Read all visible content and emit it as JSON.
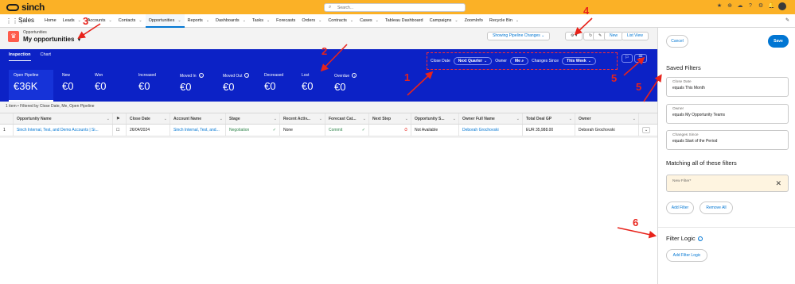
{
  "brand": {
    "name": "sinch"
  },
  "search": {
    "placeholder": "Search..."
  },
  "app": {
    "name": "Sales"
  },
  "nav": [
    {
      "label": "Home",
      "chev": false
    },
    {
      "label": "Leads",
      "chev": true
    },
    {
      "label": "Accounts",
      "chev": true
    },
    {
      "label": "Contacts",
      "chev": true
    },
    {
      "label": "Opportunities",
      "chev": true,
      "active": true
    },
    {
      "label": "Reports",
      "chev": true
    },
    {
      "label": "Dashboards",
      "chev": true
    },
    {
      "label": "Tasks",
      "chev": true
    },
    {
      "label": "Forecasts",
      "chev": false
    },
    {
      "label": "Orders",
      "chev": true
    },
    {
      "label": "Contracts",
      "chev": true
    },
    {
      "label": "Cases",
      "chev": true
    },
    {
      "label": "Tableau Dashboard",
      "chev": false
    },
    {
      "label": "Campaigns",
      "chev": true
    },
    {
      "label": "ZoomInfo",
      "chev": false
    },
    {
      "label": "Recycle Bin",
      "chev": true
    }
  ],
  "header": {
    "object_label": "Opportunities",
    "list_name": "My opportunities",
    "pipeline_btn": "Showing Pipeline Changes",
    "new_btn": "New",
    "listview_btn": "List View"
  },
  "tabs": [
    "Inspection",
    "Chart"
  ],
  "filters": {
    "close_date_label": "Close Date",
    "close_date_value": "Next Quarter",
    "owner_label": "Owner",
    "owner_value": "Me",
    "changes_label": "Changes Since",
    "changes_value": "This Week"
  },
  "metrics": [
    {
      "label": "Open Pipeline",
      "value": "€36K"
    },
    {
      "label": "New",
      "value": "€0"
    },
    {
      "label": "Won",
      "value": "€0"
    },
    {
      "label": "Increased",
      "value": "€0"
    },
    {
      "label": "Moved In",
      "value": "€0"
    },
    {
      "label": "Moved Out",
      "value": "€0"
    },
    {
      "label": "Decreased",
      "value": "€0"
    },
    {
      "label": "Lost",
      "value": "€0"
    },
    {
      "label": "Overdue",
      "value": "€0"
    }
  ],
  "status": "1 item • Filtered by Close Date, Me, Open Pipeline",
  "table": {
    "columns": [
      "Opportunity Name",
      "Close Date",
      "Account Name",
      "Stage",
      "Recent Activ...",
      "Forecast Cat...",
      "Next Step",
      "Opportunity S...",
      "Owner Full Name",
      "Total Deal GP",
      "Owner"
    ],
    "row": {
      "num": "1",
      "name": "Sinch Internal, Test, and Demo Accounts | Si...",
      "close_date": "26/04/2024",
      "account": "Sinch Internal, Test, and...",
      "stage": "Negotiation",
      "recent": "None",
      "forecast": "Commit",
      "next_step": "",
      "opp_status": "Not Available",
      "owner_full": "Deborah Grochovski",
      "gp": "EUR 35,988.00",
      "owner": "Deborah Grochovski"
    }
  },
  "panel": {
    "cancel": "Cancel",
    "save": "Save",
    "saved_title": "Saved Filters",
    "saved": [
      {
        "name": "Close Date",
        "value": "equals  This Month"
      },
      {
        "name": "Owner",
        "value": "equals  My Opportunity Teams"
      },
      {
        "name": "Changes Since",
        "value": "equals  Start of the Period"
      }
    ],
    "matching_title": "Matching all of these filters",
    "new_filter": "New Filter*",
    "add_filter": "Add Filter",
    "remove_all": "Remove All",
    "logic_title": "Filter Logic",
    "add_logic": "Add Filter Logic"
  },
  "annotations": [
    "1",
    "2",
    "3",
    "4",
    "5",
    "5",
    "6"
  ],
  "colors": {
    "topbar": "#fbb126",
    "banner": "#0c22c6",
    "accent": "#0176d3",
    "annotation": "#e8231b"
  }
}
